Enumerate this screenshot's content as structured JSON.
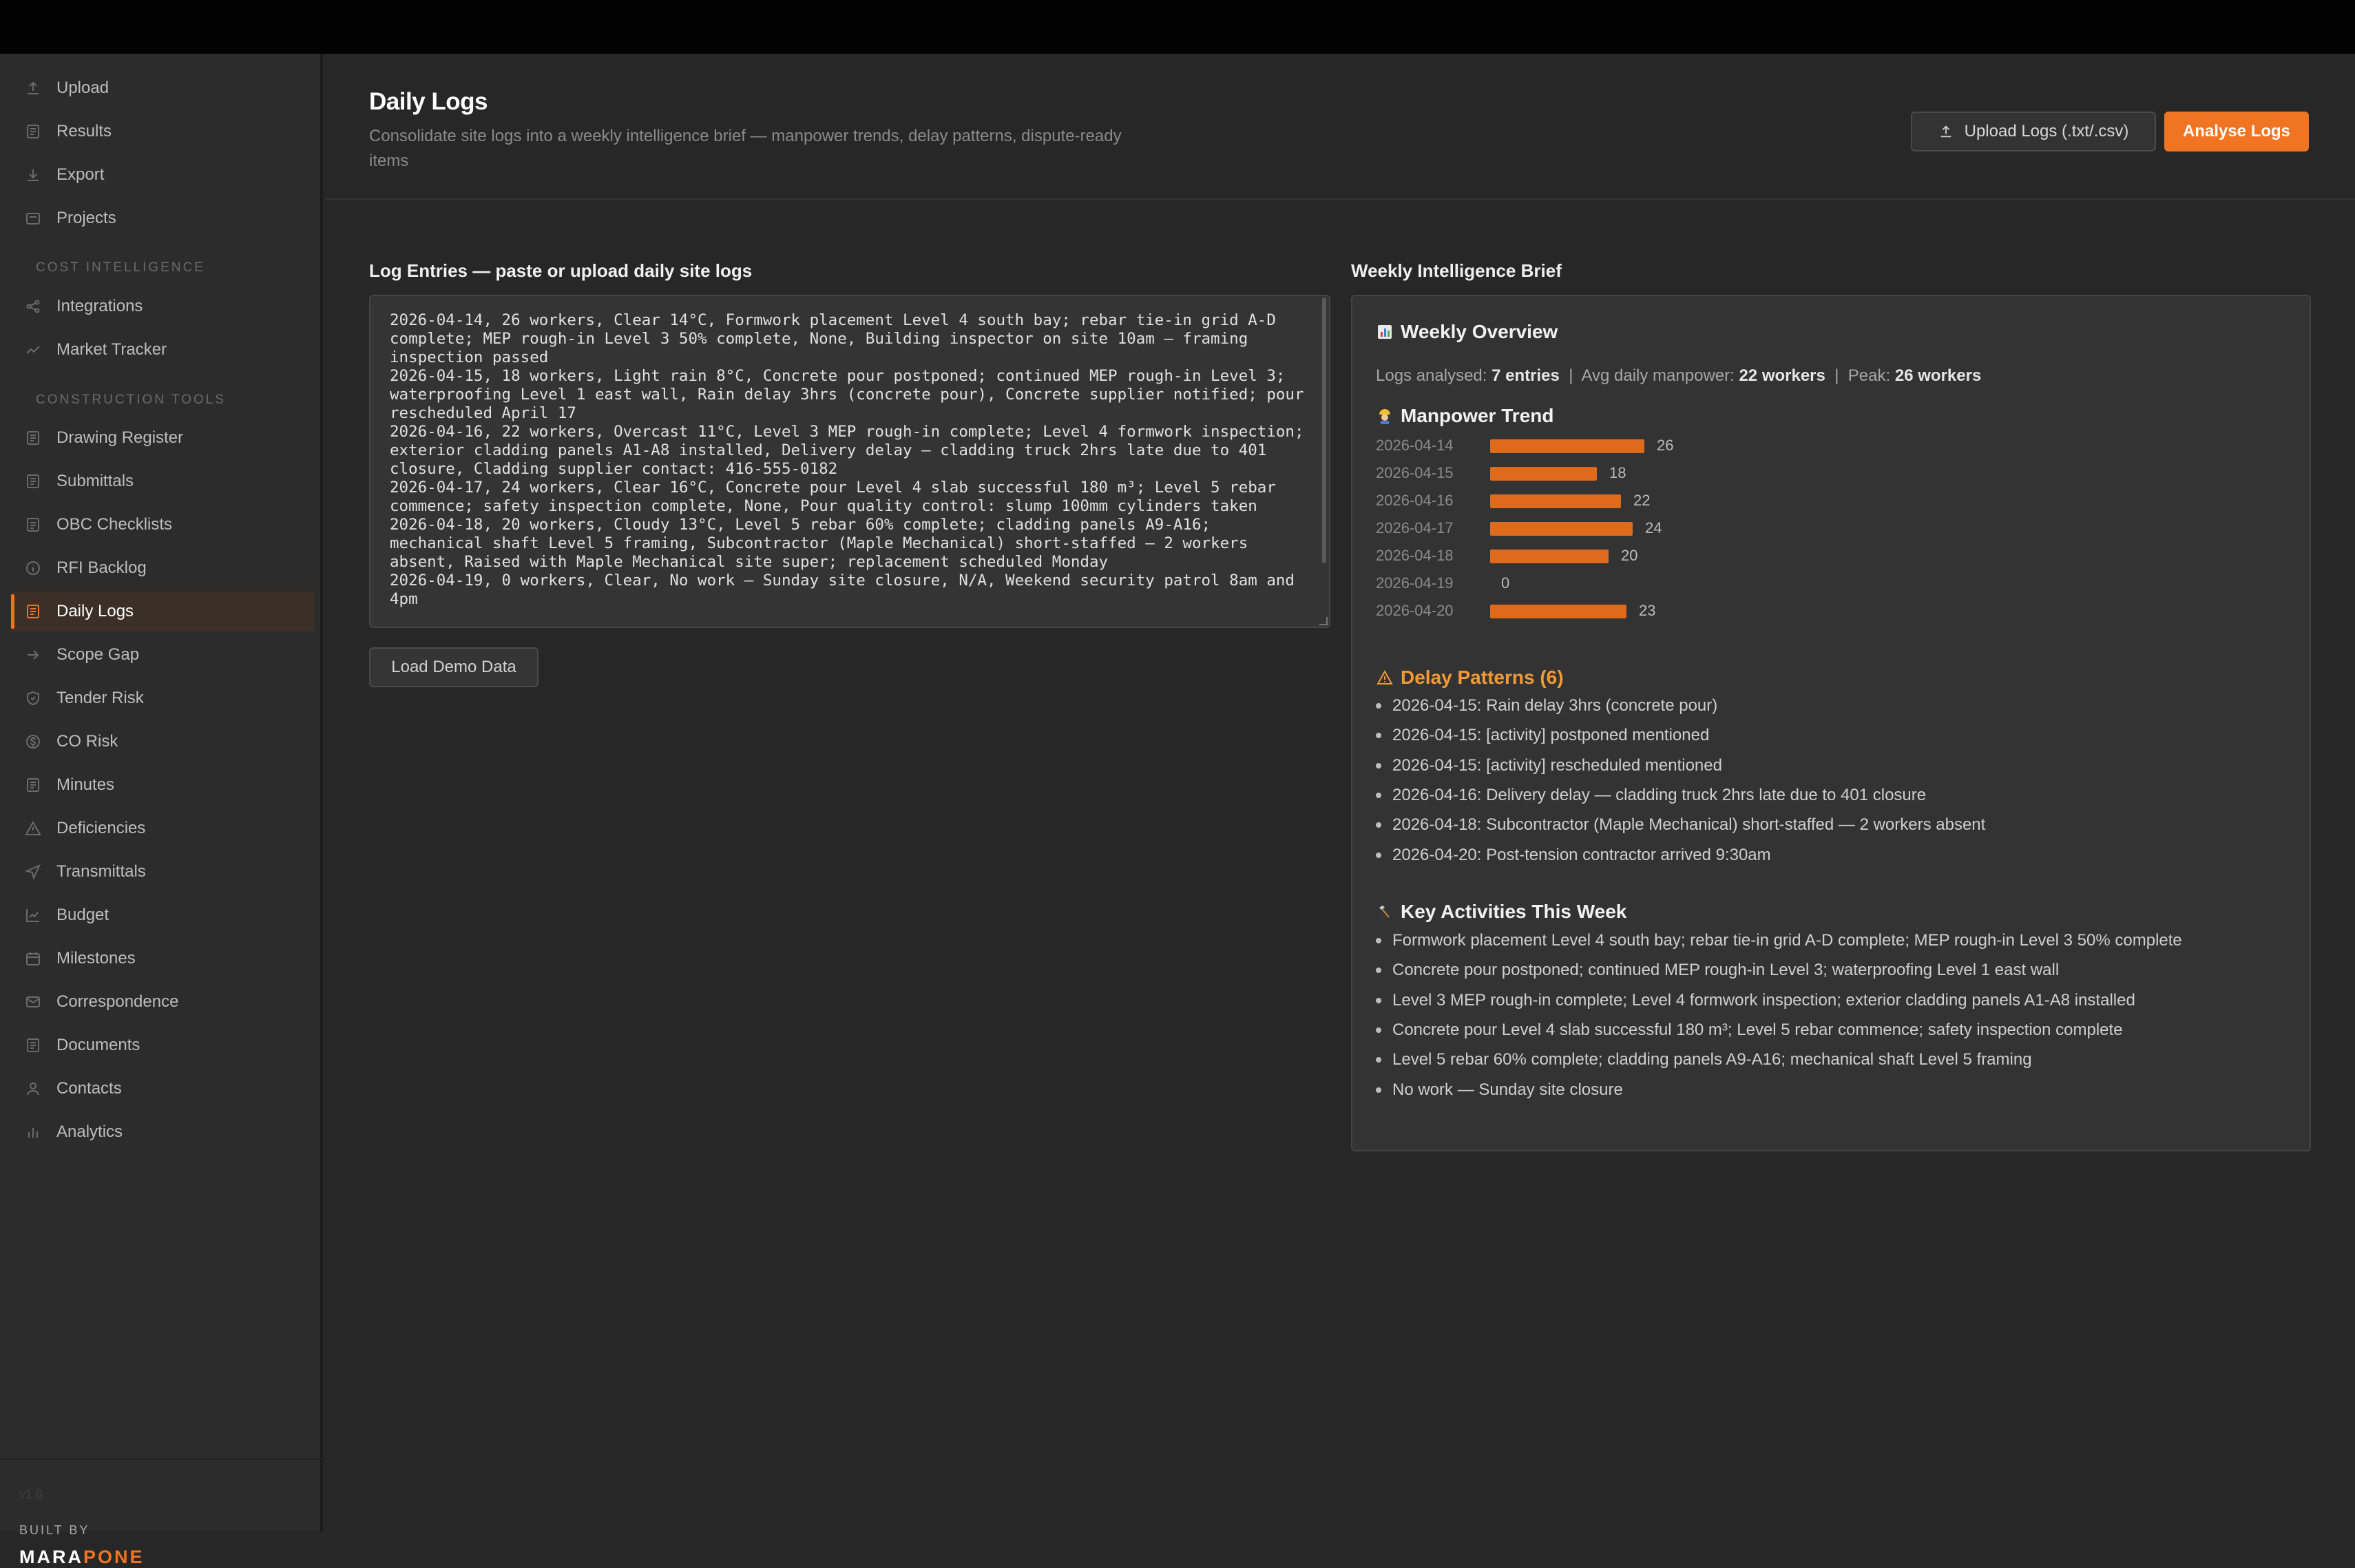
{
  "sidebar": {
    "top_items": [
      {
        "label": "Upload",
        "icon": "upload-icon"
      },
      {
        "label": "Results",
        "icon": "document-icon"
      },
      {
        "label": "Export",
        "icon": "download-icon"
      },
      {
        "label": "Projects",
        "icon": "folder-icon"
      }
    ],
    "section_cost": "COST INTELLIGENCE",
    "cost_items": [
      {
        "label": "Integrations",
        "icon": "share-icon"
      },
      {
        "label": "Market Tracker",
        "icon": "trend-icon"
      }
    ],
    "section_construction": "CONSTRUCTION TOOLS",
    "construction_items": [
      {
        "label": "Drawing Register",
        "icon": "document-icon"
      },
      {
        "label": "Submittals",
        "icon": "document-icon"
      },
      {
        "label": "OBC Checklists",
        "icon": "checklist-icon"
      },
      {
        "label": "RFI Backlog",
        "icon": "info-icon"
      },
      {
        "label": "Daily Logs",
        "icon": "document-icon",
        "active": true
      },
      {
        "label": "Scope Gap",
        "icon": "arrow-right-icon"
      },
      {
        "label": "Tender Risk",
        "icon": "shield-icon"
      },
      {
        "label": "CO Risk",
        "icon": "dollar-icon"
      },
      {
        "label": "Minutes",
        "icon": "document-icon"
      },
      {
        "label": "Deficiencies",
        "icon": "warning-icon"
      },
      {
        "label": "Transmittals",
        "icon": "send-icon"
      },
      {
        "label": "Budget",
        "icon": "chart-line-icon"
      },
      {
        "label": "Milestones",
        "icon": "calendar-icon"
      },
      {
        "label": "Correspondence",
        "icon": "mail-icon"
      },
      {
        "label": "Documents",
        "icon": "document-icon"
      },
      {
        "label": "Contacts",
        "icon": "person-icon"
      },
      {
        "label": "Analytics",
        "icon": "bar-chart-icon"
      }
    ],
    "version": "v1.0",
    "built_by": "BUILT BY",
    "brand_part1": "MARA",
    "brand_part2": "PONE"
  },
  "header": {
    "title": "Daily Logs",
    "subtitle": "Consolidate site logs into a weekly intelligence brief — manpower trends, delay patterns, dispute-ready items",
    "upload_button": "Upload Logs (.txt/.csv)",
    "analyse_button": "Analyse Logs"
  },
  "log_panel": {
    "title": "Log Entries — paste or upload daily site logs",
    "text": "2026-04-14, 26 workers, Clear 14°C, Formwork placement Level 4 south bay; rebar tie-in grid A-D complete; MEP rough-in Level 3 50% complete, None, Building inspector on site 10am — framing inspection passed\n2026-04-15, 18 workers, Light rain 8°C, Concrete pour postponed; continued MEP rough-in Level 3; waterproofing Level 1 east wall, Rain delay 3hrs (concrete pour), Concrete supplier notified; pour rescheduled April 17\n2026-04-16, 22 workers, Overcast 11°C, Level 3 MEP rough-in complete; Level 4 formwork inspection; exterior cladding panels A1-A8 installed, Delivery delay — cladding truck 2hrs late due to 401 closure, Cladding supplier contact: 416-555-0182\n2026-04-17, 24 workers, Clear 16°C, Concrete pour Level 4 slab successful 180 m³; Level 5 rebar commence; safety inspection complete, None, Pour quality control: slump 100mm cylinders taken\n2026-04-18, 20 workers, Cloudy 13°C, Level 5 rebar 60% complete; cladding panels A9-A16; mechanical shaft Level 5 framing, Subcontractor (Maple Mechanical) short-staffed — 2 workers absent, Raised with Maple Mechanical site super; replacement scheduled Monday\n2026-04-19, 0 workers, Clear, No work — Sunday site closure, N/A, Weekend security patrol 8am and 4pm",
    "demo_button": "Load Demo Data"
  },
  "brief": {
    "title": "Weekly Intelligence Brief",
    "overview_title": "Weekly Overview",
    "overview_icon": "bar-chart-emoji",
    "stats": {
      "logs_label": "Logs analysed:",
      "logs_value": "7 entries",
      "avg_label": "Avg daily manpower:",
      "avg_value": "22 workers",
      "peak_label": "Peak:",
      "peak_value": "26 workers",
      "separator": "|"
    },
    "trend_title": "Manpower Trend",
    "trend_icon": "worker-emoji",
    "trend": [
      {
        "date": "2026-04-14",
        "value": 26
      },
      {
        "date": "2026-04-15",
        "value": 18
      },
      {
        "date": "2026-04-16",
        "value": 22
      },
      {
        "date": "2026-04-17",
        "value": 24
      },
      {
        "date": "2026-04-18",
        "value": 20
      },
      {
        "date": "2026-04-19",
        "value": 0
      },
      {
        "date": "2026-04-20",
        "value": 23
      }
    ],
    "delay_title": "Delay Patterns (6)",
    "delay_icon": "warning-emoji",
    "delays": [
      "2026-04-15: Rain delay 3hrs (concrete pour)",
      "2026-04-15: [activity] postponed mentioned",
      "2026-04-15: [activity] rescheduled mentioned",
      "2026-04-16: Delivery delay — cladding truck 2hrs late due to 401 closure",
      "2026-04-18: Subcontractor (Maple Mechanical) short-staffed — 2 workers absent",
      "2026-04-20: Post-tension contractor arrived 9:30am"
    ],
    "activities_title": "Key Activities This Week",
    "activities_icon": "hammer-emoji",
    "activities": [
      "Formwork placement Level 4 south bay; rebar tie-in grid A-D complete; MEP rough-in Level 3 50% complete",
      "Concrete pour postponed; continued MEP rough-in Level 3; waterproofing Level 1 east wall",
      "Level 3 MEP rough-in complete; Level 4 formwork inspection; exterior cladding panels A1-A8 installed",
      "Concrete pour Level 4 slab successful 180 m³; Level 5 rebar commence; safety inspection complete",
      "Level 5 rebar 60% complete; cladding panels A9-A16; mechanical shaft Level 5 framing",
      "No work — Sunday site closure"
    ]
  },
  "colors": {
    "accent": "#f07422",
    "warning": "#f39a35",
    "bar": "#e06a1b"
  }
}
